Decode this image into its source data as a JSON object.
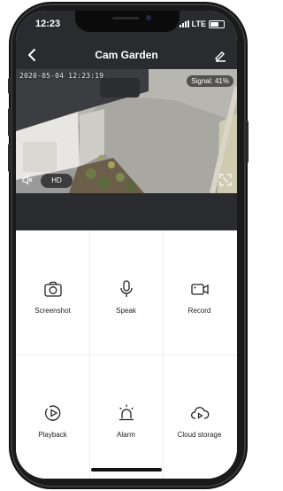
{
  "status": {
    "time": "12:23",
    "network": "LTE"
  },
  "nav": {
    "title": "Cam Garden",
    "back_icon": "chevron-left-icon",
    "edit_icon": "pencil-icon"
  },
  "video": {
    "timestamp": "2020-05-04 12:23:19",
    "signal": "Signal: 41%",
    "quality": "HD",
    "mute_icon": "speaker-mute-icon",
    "fullscreen_icon": "fullscreen-icon"
  },
  "actions": [
    {
      "label": "Screenshot",
      "icon": "camera-icon"
    },
    {
      "label": "Speak",
      "icon": "microphone-icon"
    },
    {
      "label": "Record",
      "icon": "video-record-icon"
    },
    {
      "label": "Playback",
      "icon": "playback-icon"
    },
    {
      "label": "Alarm",
      "icon": "siren-icon"
    },
    {
      "label": "Cloud storage",
      "icon": "cloud-play-icon"
    }
  ],
  "colors": {
    "header_bg": "#2a2b2f",
    "text": "#222222"
  }
}
